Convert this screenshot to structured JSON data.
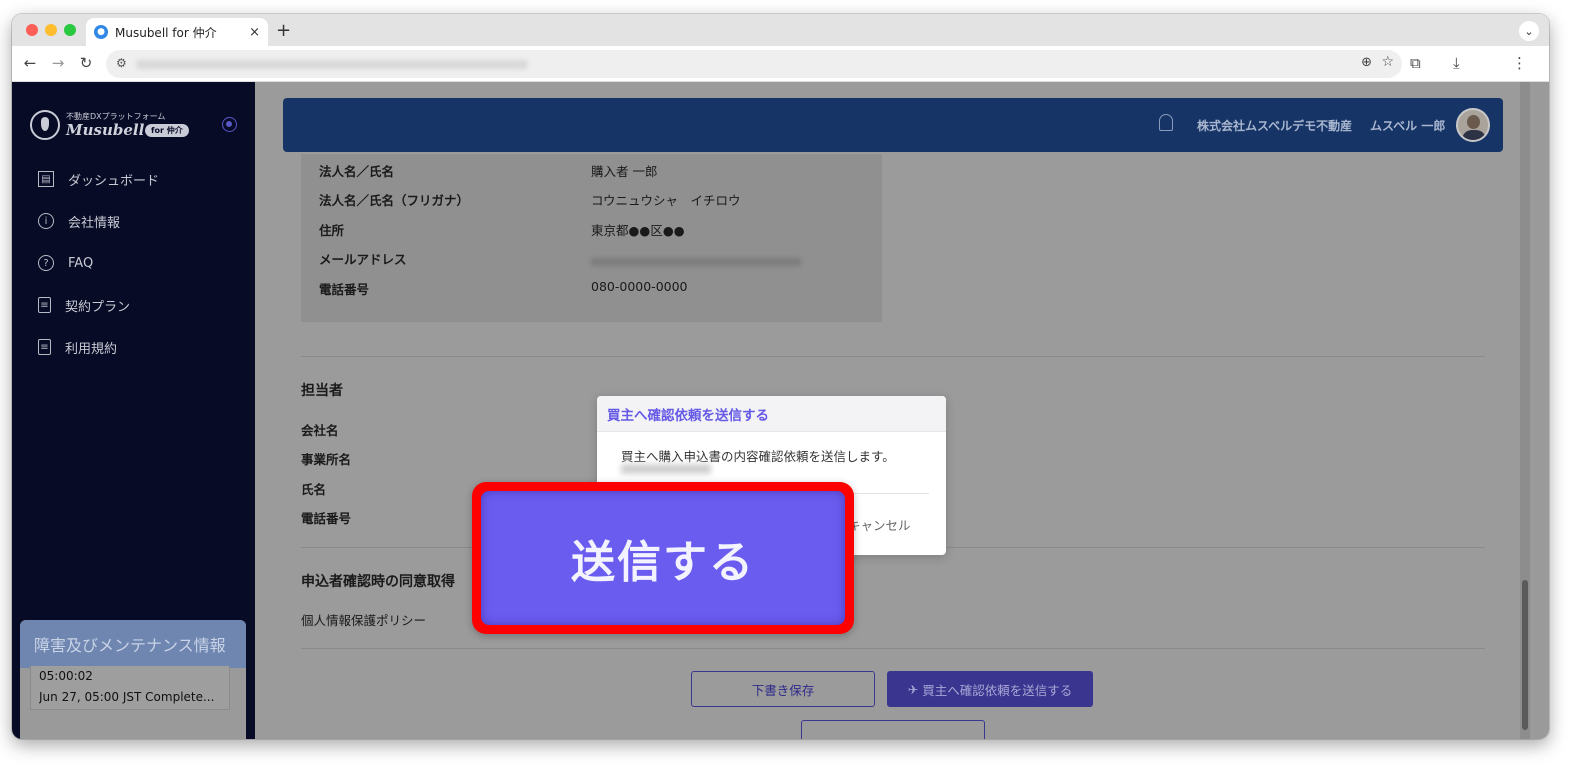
{
  "browser": {
    "tab_title": "Musubell for 仲介",
    "tab_close": "×",
    "new_tab": "+",
    "tab_menu": "⌄"
  },
  "app": {
    "logo_sub": "不動産DXプラットフォーム",
    "logo_name": "Musubell",
    "logo_badge": "for 仲介",
    "nav": [
      {
        "label": "ダッシュボード",
        "icon": "dashboard-icon"
      },
      {
        "label": "会社情報",
        "icon": "info-icon"
      },
      {
        "label": "FAQ",
        "icon": "help-icon"
      },
      {
        "label": "契約プラン",
        "icon": "document-icon"
      },
      {
        "label": "利用規約",
        "icon": "document-icon"
      }
    ],
    "maintenance": {
      "title": "障害及びメンテナンス情報",
      "line1": "05:00:02",
      "line2": "Jun 27, 05:00 JST Complete..."
    }
  },
  "header": {
    "company": "株式会社ムスベルデモ不動産",
    "user": "ムスベル 一郎"
  },
  "buyer": {
    "name_label": "法人名／氏名",
    "name_value": "購入者 一郎",
    "kana_label": "法人名／氏名（フリガナ）",
    "kana_value": "コウニュウシャ　イチロウ",
    "address_label": "住所",
    "address_value": "東京都●●区●●",
    "email_label": "メールアドレス",
    "phone_label": "電話番号",
    "phone_value": "080-0000-0000"
  },
  "agent": {
    "section_title": "担当者",
    "company_label": "会社名",
    "office_label": "事業所名",
    "name_label": "氏名",
    "phone_label": "電話番号"
  },
  "consent": {
    "section_title": "申込者確認時の同意取得",
    "policy_label": "個人情報保護ポリシー"
  },
  "actions": {
    "draft_save": "下書き保存",
    "send_to_buyer": "買主へ確認依頼を送信する",
    "send_icon": "send-icon"
  },
  "dialog": {
    "title": "買主へ確認依頼を送信する",
    "body": "買主へ購入申込書の内容確認依頼を送信します。",
    "cancel": "キャンセル"
  },
  "callout": {
    "label": "送信する"
  },
  "colors": {
    "sidebar_bg": "#070b26",
    "header_bg": "#163466",
    "accent": "#6b5cf0",
    "highlight": "#ff0000"
  }
}
